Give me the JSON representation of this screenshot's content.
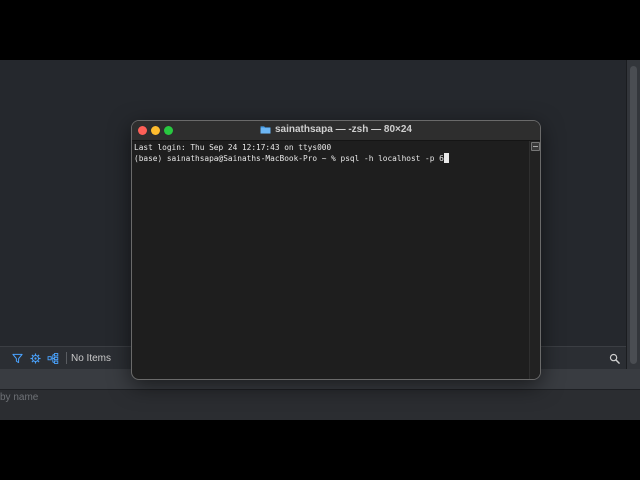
{
  "terminal": {
    "title": "sainathsapa — -zsh — 80×24",
    "lines": [
      "Last login: Thu Sep 24 12:17:43 on ttys000",
      "(base) sainathsapa@Sainaths-MacBook-Pro ~ % psql -h localhost -p 6"
    ]
  },
  "status_bar": {
    "no_items_label": "No Items"
  },
  "filter": {
    "placeholder": "by name"
  },
  "icons": {
    "filter": "filter-icon",
    "settings": "gear-icon",
    "hierarchy": "hierarchy-icon",
    "search": "search-icon",
    "folder": "folder-icon"
  },
  "colors": {
    "accent": "#4aa3ff",
    "close": "#fe5f57",
    "minimize": "#febc2e",
    "zoom": "#28c840"
  }
}
